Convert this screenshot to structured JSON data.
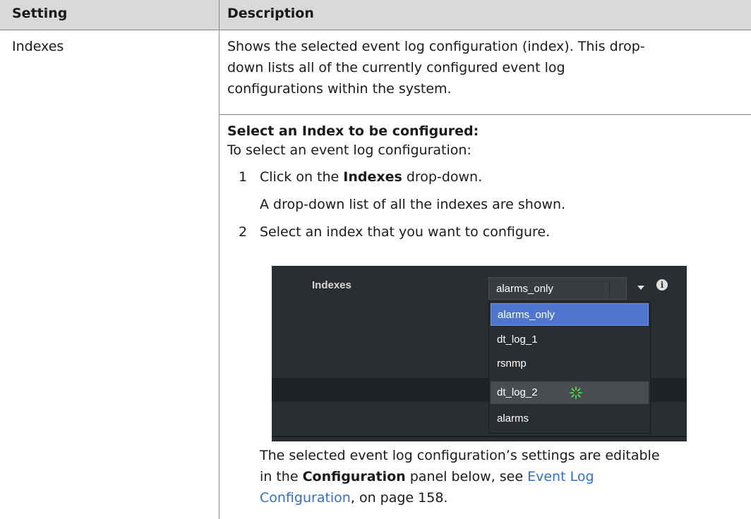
{
  "table": {
    "header": {
      "setting": "Setting",
      "description": "Description"
    },
    "row": {
      "setting": "Indexes",
      "para1": [
        "Shows the selected event log configuration (index). This drop-",
        "down lists all of the currently configured event log",
        "configurations within the system."
      ],
      "subheading": "Select an Index to be configured:",
      "intro": "To select an event log configuration:",
      "steps": [
        {
          "num": "1",
          "pre": "Click on the ",
          "bold": "Indexes",
          "post": " drop-down."
        },
        {
          "result": "A drop-down list of all the indexes are shown."
        },
        {
          "num": "2",
          "text": "Select an index that you want to configure."
        }
      ],
      "closing": {
        "line1": "The selected event log configuration’s settings are editable",
        "line2_pre": "in the ",
        "line2_bold": "Configuration",
        "line2_mid": " panel below, see ",
        "link_part1": "Event Log",
        "link_part2": "Configuration",
        "line3_post": ", on page 158."
      }
    }
  },
  "screenshot": {
    "label": "Indexes",
    "selected_value": "alarms_only",
    "options": [
      "alarms_only",
      "dt_log_1",
      "rsnmp",
      "dt_log_2",
      "alarms"
    ],
    "highlighted_option": "alarms_only",
    "hovered_option": "dt_log_2",
    "colors": {
      "background": "#2b2e30",
      "highlight": "#4f76cf",
      "spinner": "#3cff3c"
    }
  }
}
